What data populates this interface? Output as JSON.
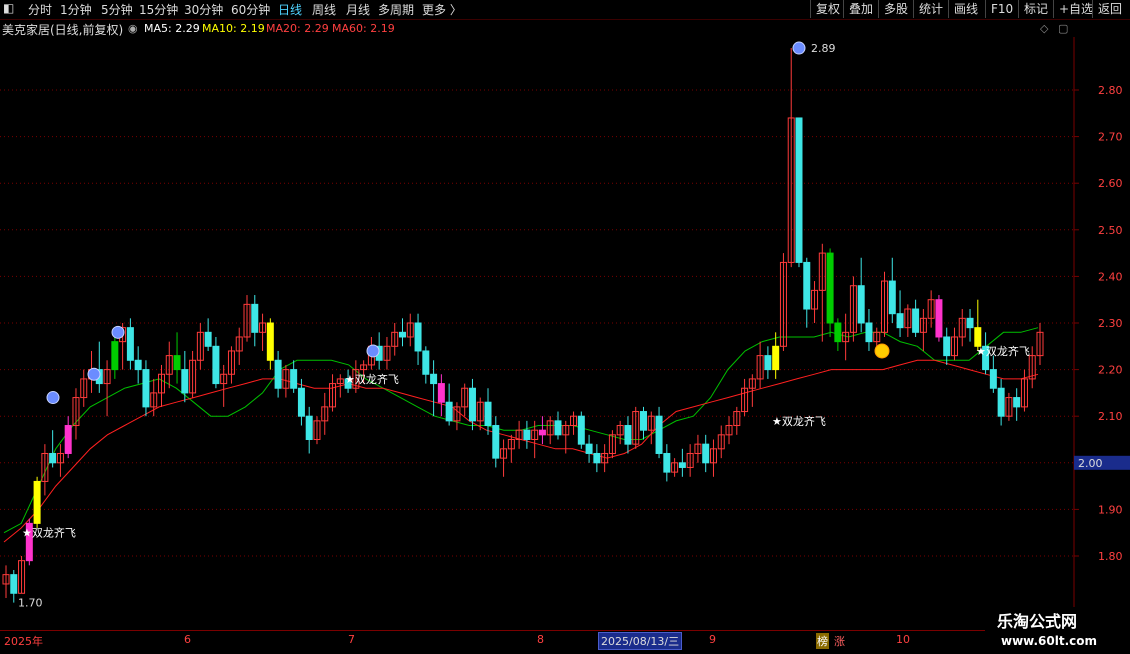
{
  "toolbar": {
    "back_glyph": "◧",
    "periods": [
      "分时",
      "1分钟",
      "5分钟",
      "15分钟",
      "30分钟",
      "60分钟",
      "日线",
      "周线",
      "月线",
      "多周期",
      "更多 〉"
    ],
    "active_period": "日线",
    "tools": [
      "复权",
      "叠加",
      "多股",
      "统计",
      "画线",
      "F10",
      "标记",
      "+自选",
      "返回"
    ]
  },
  "info": {
    "title": "美克家居(日线,前复权)",
    "dropdown_glyph": "◉",
    "ma5": "MA5: 2.29",
    "ma10": "MA10: 2.19",
    "ma20": "MA20: 2.29",
    "ma60": "MA60: 2.19",
    "diamond": "◇",
    "box": "▢"
  },
  "colors": {
    "up": "#ff3b3b",
    "down": "#3ee6e6",
    "ma5": "#ffffff",
    "ma10": "#ffff00",
    "ma20": "#00c000",
    "ma60": "#ff2020",
    "yellow_signal": "#ffff00",
    "green_signal": "#00cc00",
    "magenta_signal": "#ff33cc",
    "grid": "#7a0000"
  },
  "axis": {
    "price_labels": [
      "2.80",
      "2.70",
      "2.60",
      "2.50",
      "2.40",
      "2.30",
      "2.20",
      "2.10",
      "2.00",
      "1.90",
      "1.80"
    ],
    "current_price": "2.00"
  },
  "annotations": {
    "high": "2.89",
    "low": "1.70",
    "dragon": "★双龙齐飞"
  },
  "dates": {
    "year": "2025年",
    "months": [
      "6",
      "7",
      "8",
      "9",
      "10"
    ],
    "cursor_date": "2025/08/13/三",
    "tag": "榜",
    "tag2": "涨"
  },
  "chart_data": {
    "type": "candlestick",
    "title": "美克家居(日线,前复权)",
    "ylim": [
      1.67,
      2.93
    ],
    "y_ticks": [
      1.8,
      1.9,
      2.0,
      2.1,
      2.2,
      2.3,
      2.4,
      2.5,
      2.6,
      2.7,
      2.8
    ],
    "high_marker": 2.89,
    "low_marker": 1.7,
    "ohlc": [
      [
        1.74,
        1.78,
        1.71,
        1.76
      ],
      [
        1.76,
        1.77,
        1.7,
        1.72
      ],
      [
        1.72,
        1.8,
        1.72,
        1.79
      ],
      [
        1.79,
        1.88,
        1.78,
        1.87
      ],
      [
        1.87,
        1.97,
        1.86,
        1.96
      ],
      [
        1.96,
        2.04,
        1.93,
        2.02
      ],
      [
        2.02,
        2.07,
        1.99,
        2.0
      ],
      [
        2.0,
        2.04,
        1.97,
        2.02
      ],
      [
        2.02,
        2.1,
        2.01,
        2.08
      ],
      [
        2.08,
        2.16,
        2.05,
        2.14
      ],
      [
        2.14,
        2.2,
        2.12,
        2.18
      ],
      [
        2.18,
        2.24,
        2.15,
        2.2
      ],
      [
        2.2,
        2.26,
        2.15,
        2.17
      ],
      [
        2.17,
        2.22,
        2.1,
        2.2
      ],
      [
        2.2,
        2.28,
        2.18,
        2.26
      ],
      [
        2.26,
        2.3,
        2.2,
        2.29
      ],
      [
        2.29,
        2.31,
        2.2,
        2.22
      ],
      [
        2.22,
        2.25,
        2.17,
        2.2
      ],
      [
        2.2,
        2.22,
        2.1,
        2.12
      ],
      [
        2.12,
        2.18,
        2.1,
        2.15
      ],
      [
        2.15,
        2.21,
        2.12,
        2.19
      ],
      [
        2.19,
        2.26,
        2.16,
        2.23
      ],
      [
        2.23,
        2.28,
        2.17,
        2.2
      ],
      [
        2.2,
        2.24,
        2.13,
        2.15
      ],
      [
        2.15,
        2.24,
        2.14,
        2.22
      ],
      [
        2.22,
        2.3,
        2.2,
        2.28
      ],
      [
        2.28,
        2.31,
        2.24,
        2.25
      ],
      [
        2.25,
        2.27,
        2.16,
        2.17
      ],
      [
        2.17,
        2.21,
        2.12,
        2.19
      ],
      [
        2.19,
        2.25,
        2.17,
        2.24
      ],
      [
        2.24,
        2.29,
        2.21,
        2.27
      ],
      [
        2.27,
        2.36,
        2.26,
        2.34
      ],
      [
        2.34,
        2.36,
        2.25,
        2.28
      ],
      [
        2.28,
        2.32,
        2.24,
        2.3
      ],
      [
        2.3,
        2.31,
        2.2,
        2.22
      ],
      [
        2.22,
        2.24,
        2.14,
        2.16
      ],
      [
        2.16,
        2.21,
        2.14,
        2.2
      ],
      [
        2.2,
        2.22,
        2.15,
        2.16
      ],
      [
        2.16,
        2.18,
        2.08,
        2.1
      ],
      [
        2.1,
        2.12,
        2.02,
        2.05
      ],
      [
        2.05,
        2.1,
        2.04,
        2.09
      ],
      [
        2.09,
        2.15,
        2.06,
        2.12
      ],
      [
        2.12,
        2.19,
        2.11,
        2.17
      ],
      [
        2.17,
        2.19,
        2.14,
        2.18
      ],
      [
        2.18,
        2.2,
        2.15,
        2.16
      ],
      [
        2.16,
        2.22,
        2.15,
        2.2
      ],
      [
        2.2,
        2.22,
        2.17,
        2.21
      ],
      [
        2.21,
        2.27,
        2.2,
        2.25
      ],
      [
        2.25,
        2.28,
        2.2,
        2.22
      ],
      [
        2.22,
        2.27,
        2.2,
        2.25
      ],
      [
        2.25,
        2.3,
        2.23,
        2.28
      ],
      [
        2.28,
        2.31,
        2.25,
        2.27
      ],
      [
        2.27,
        2.32,
        2.25,
        2.3
      ],
      [
        2.3,
        2.32,
        2.21,
        2.24
      ],
      [
        2.24,
        2.25,
        2.17,
        2.19
      ],
      [
        2.19,
        2.22,
        2.1,
        2.17
      ],
      [
        2.17,
        2.19,
        2.1,
        2.13
      ],
      [
        2.13,
        2.17,
        2.08,
        2.09
      ],
      [
        2.09,
        2.13,
        2.07,
        2.12
      ],
      [
        2.12,
        2.17,
        2.1,
        2.16
      ],
      [
        2.16,
        2.18,
        2.07,
        2.09
      ],
      [
        2.09,
        2.14,
        2.07,
        2.13
      ],
      [
        2.13,
        2.16,
        2.06,
        2.08
      ],
      [
        2.08,
        2.1,
        1.99,
        2.01
      ],
      [
        2.01,
        2.05,
        1.97,
        2.03
      ],
      [
        2.03,
        2.06,
        2.0,
        2.05
      ],
      [
        2.05,
        2.09,
        2.03,
        2.07
      ],
      [
        2.07,
        2.09,
        2.03,
        2.05
      ],
      [
        2.05,
        2.09,
        2.01,
        2.07
      ],
      [
        2.07,
        2.1,
        2.04,
        2.06
      ],
      [
        2.06,
        2.1,
        2.04,
        2.09
      ],
      [
        2.09,
        2.11,
        2.05,
        2.06
      ],
      [
        2.06,
        2.09,
        2.02,
        2.08
      ],
      [
        2.08,
        2.11,
        2.06,
        2.1
      ],
      [
        2.1,
        2.11,
        2.03,
        2.04
      ],
      [
        2.04,
        2.06,
        2.0,
        2.02
      ],
      [
        2.02,
        2.04,
        1.98,
        2.0
      ],
      [
        2.0,
        2.04,
        1.98,
        2.02
      ],
      [
        2.02,
        2.07,
        2.01,
        2.06
      ],
      [
        2.06,
        2.09,
        2.04,
        2.08
      ],
      [
        2.08,
        2.1,
        2.02,
        2.04
      ],
      [
        2.04,
        2.12,
        2.03,
        2.11
      ],
      [
        2.11,
        2.12,
        2.05,
        2.07
      ],
      [
        2.07,
        2.11,
        2.04,
        2.1
      ],
      [
        2.1,
        2.12,
        2.01,
        2.02
      ],
      [
        2.02,
        2.04,
        1.96,
        1.98
      ],
      [
        1.98,
        2.01,
        1.97,
        2.0
      ],
      [
        2.0,
        2.03,
        1.97,
        1.99
      ],
      [
        1.99,
        2.04,
        1.97,
        2.02
      ],
      [
        2.02,
        2.06,
        2.0,
        2.04
      ],
      [
        2.04,
        2.06,
        1.98,
        2.0
      ],
      [
        2.0,
        2.05,
        1.97,
        2.03
      ],
      [
        2.03,
        2.08,
        2.01,
        2.06
      ],
      [
        2.06,
        2.1,
        2.04,
        2.08
      ],
      [
        2.08,
        2.12,
        2.06,
        2.11
      ],
      [
        2.11,
        2.18,
        2.1,
        2.16
      ],
      [
        2.16,
        2.19,
        2.12,
        2.18
      ],
      [
        2.18,
        2.26,
        2.16,
        2.23
      ],
      [
        2.23,
        2.25,
        2.18,
        2.2
      ],
      [
        2.2,
        2.28,
        2.18,
        2.25
      ],
      [
        2.25,
        2.45,
        2.24,
        2.43
      ],
      [
        2.43,
        2.89,
        2.42,
        2.74
      ],
      [
        2.74,
        2.74,
        2.42,
        2.43
      ],
      [
        2.43,
        2.44,
        2.29,
        2.33
      ],
      [
        2.33,
        2.39,
        2.3,
        2.37
      ],
      [
        2.37,
        2.47,
        2.26,
        2.45
      ],
      [
        2.45,
        2.46,
        2.27,
        2.3
      ],
      [
        2.3,
        2.31,
        2.24,
        2.26
      ],
      [
        2.26,
        2.32,
        2.22,
        2.28
      ],
      [
        2.28,
        2.4,
        2.26,
        2.38
      ],
      [
        2.38,
        2.44,
        2.28,
        2.3
      ],
      [
        2.3,
        2.33,
        2.24,
        2.26
      ],
      [
        2.26,
        2.29,
        2.23,
        2.28
      ],
      [
        2.28,
        2.41,
        2.27,
        2.39
      ],
      [
        2.39,
        2.44,
        2.3,
        2.32
      ],
      [
        2.32,
        2.37,
        2.27,
        2.29
      ],
      [
        2.29,
        2.34,
        2.27,
        2.33
      ],
      [
        2.33,
        2.35,
        2.27,
        2.28
      ],
      [
        2.28,
        2.33,
        2.24,
        2.31
      ],
      [
        2.31,
        2.37,
        2.29,
        2.35
      ],
      [
        2.35,
        2.36,
        2.26,
        2.27
      ],
      [
        2.27,
        2.29,
        2.21,
        2.23
      ],
      [
        2.23,
        2.29,
        2.22,
        2.27
      ],
      [
        2.27,
        2.33,
        2.25,
        2.31
      ],
      [
        2.31,
        2.33,
        2.26,
        2.29
      ],
      [
        2.29,
        2.35,
        2.24,
        2.25
      ],
      [
        2.25,
        2.28,
        2.19,
        2.2
      ],
      [
        2.2,
        2.23,
        2.15,
        2.16
      ],
      [
        2.16,
        2.18,
        2.08,
        2.1
      ],
      [
        2.1,
        2.15,
        2.09,
        2.14
      ],
      [
        2.14,
        2.16,
        2.09,
        2.12
      ],
      [
        2.12,
        2.2,
        2.11,
        2.18
      ],
      [
        2.18,
        2.25,
        2.16,
        2.23
      ],
      [
        2.23,
        2.3,
        2.21,
        2.28
      ]
    ],
    "ma20_line": [
      1.85,
      1.87,
      1.95,
      2.03,
      2.08,
      2.12,
      2.14,
      2.16,
      2.17,
      2.18,
      2.16,
      2.13,
      2.1,
      2.1,
      2.12,
      2.15,
      2.2,
      2.22,
      2.22,
      2.22,
      2.21,
      2.18,
      2.16,
      2.14,
      2.12,
      2.1,
      2.09,
      2.08,
      2.08,
      2.07,
      2.07,
      2.08,
      2.08,
      2.08,
      2.07,
      2.06,
      2.05,
      2.05,
      2.07,
      2.09,
      2.1,
      2.14,
      2.2,
      2.24,
      2.26,
      2.27,
      2.27,
      2.27,
      2.28,
      2.27,
      2.28,
      2.28,
      2.26,
      2.25,
      2.22,
      2.22,
      2.22,
      2.25,
      2.28,
      2.28,
      2.29
    ],
    "ma60_line": [
      1.83,
      1.86,
      1.9,
      1.95,
      1.99,
      2.03,
      2.06,
      2.08,
      2.1,
      2.12,
      2.13,
      2.14,
      2.15,
      2.16,
      2.17,
      2.18,
      2.18,
      2.17,
      2.16,
      2.16,
      2.17,
      2.16,
      2.16,
      2.15,
      2.14,
      2.13,
      2.12,
      2.09,
      2.07,
      2.06,
      2.05,
      2.04,
      2.03,
      2.03,
      2.02,
      2.01,
      2.02,
      2.04,
      2.08,
      2.11,
      2.12,
      2.13,
      2.14,
      2.15,
      2.16,
      2.17,
      2.18,
      2.19,
      2.2,
      2.2,
      2.2,
      2.2,
      2.21,
      2.22,
      2.22,
      2.21,
      2.2,
      2.19,
      2.18,
      2.18,
      2.19
    ]
  }
}
